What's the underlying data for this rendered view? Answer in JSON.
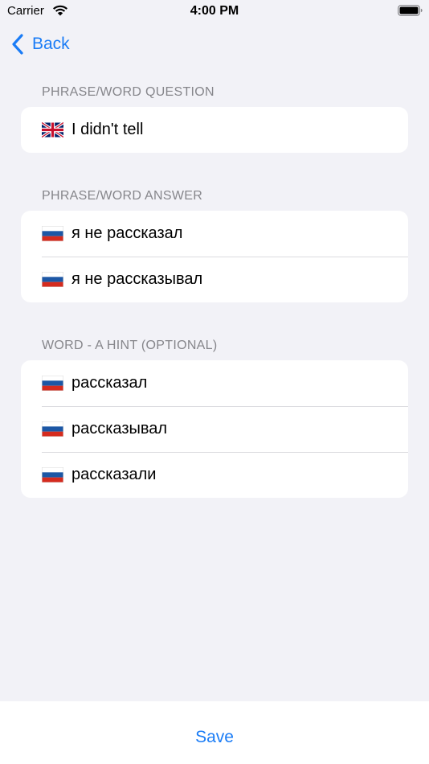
{
  "status_bar": {
    "carrier": "Carrier",
    "time": "4:00 PM"
  },
  "nav": {
    "back_label": "Back"
  },
  "sections": [
    {
      "header": "PHRASE/WORD QUESTION",
      "rows": [
        {
          "flag": "uk-flag-icon",
          "text": "I didn't tell"
        }
      ]
    },
    {
      "header": "PHRASE/WORD ANSWER",
      "rows": [
        {
          "flag": "russia-flag-icon",
          "text": "я не рассказал"
        },
        {
          "flag": "russia-flag-icon",
          "text": "я не рассказывал"
        }
      ]
    },
    {
      "header": "WORD - A HINT (OPTIONAL)",
      "rows": [
        {
          "flag": "russia-flag-icon",
          "text": "рассказал"
        },
        {
          "flag": "russia-flag-icon",
          "text": "рассказывал"
        },
        {
          "flag": "russia-flag-icon",
          "text": "рассказали"
        }
      ]
    }
  ],
  "footer": {
    "save_label": "Save"
  },
  "colors": {
    "accent": "#1a7cf6",
    "background": "#f2f2f7",
    "card": "#ffffff",
    "header_text": "#86868b"
  }
}
